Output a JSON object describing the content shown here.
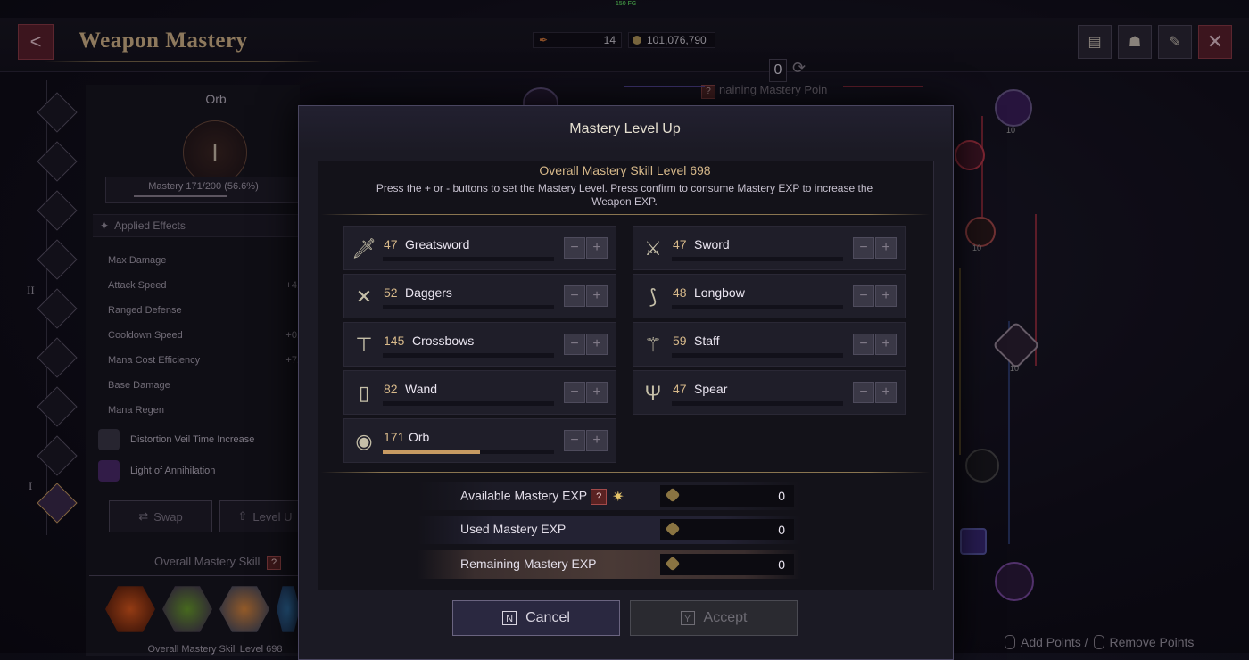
{
  "fps": "150 FG",
  "header": {
    "back_glyph": "<",
    "title": "Weapon Mastery",
    "points_value": "14",
    "currency_value": "101,076,790"
  },
  "top_right_icons": [
    "chat-icon",
    "character-icon",
    "skill-book-icon",
    "close-icon"
  ],
  "tree": {
    "remaining_points_label": "naining Mastery Poin",
    "remaining_points_value": "0",
    "node_levels": [
      "10",
      "10",
      "10"
    ]
  },
  "left_panel": {
    "weapon_title": "Orb",
    "emblem_numeral": "I",
    "mastery_text": "Mastery 171/200 (56.6%)",
    "mastery_progress": 0.566,
    "applied_effects_label": "Applied Effects",
    "effects": [
      {
        "name": "Max Damage",
        "value": ""
      },
      {
        "name": "Attack Speed",
        "value": "+4."
      },
      {
        "name": "Ranged Defense",
        "value": ""
      },
      {
        "name": "Cooldown Speed",
        "value": "+0."
      },
      {
        "name": "Mana Cost Efficiency",
        "value": "+7."
      },
      {
        "name": "Base Damage",
        "value": ""
      },
      {
        "name": "Mana Regen",
        "value": ""
      }
    ],
    "special_effects": [
      "Distortion Veil Time Increase",
      "Light of Annihilation"
    ],
    "swap_label": "Swap",
    "level_up_label": "Level U",
    "overall_skill_title": "Overall Mastery Skill",
    "overall_skill_level": "Overall Mastery Skill Level 698",
    "roman_marks": [
      "II",
      "I"
    ]
  },
  "footer_hint": {
    "add": "Add Points /",
    "remove": "Remove Points"
  },
  "modal": {
    "title": "Mastery Level Up",
    "overall_level": "Overall Mastery Skill Level 698",
    "description": "Press the + or - buttons to set the Mastery Level. Press confirm to consume Mastery EXP to increase the Weapon EXP.",
    "weapons": [
      {
        "level": "47",
        "name": "Greatsword",
        "icon": "greatsword-icon",
        "glyph": "🗡",
        "progress": 0
      },
      {
        "level": "47",
        "name": "Sword",
        "icon": "sword-icon",
        "glyph": "⚔",
        "progress": 0
      },
      {
        "level": "52",
        "name": "Daggers",
        "icon": "daggers-icon",
        "glyph": "✕",
        "progress": 0
      },
      {
        "level": "48",
        "name": "Longbow",
        "icon": "longbow-icon",
        "glyph": "⟆",
        "progress": 0
      },
      {
        "level": "145",
        "name": "Crossbows",
        "icon": "crossbow-icon",
        "glyph": "⊤",
        "progress": 0
      },
      {
        "level": "59",
        "name": "Staff",
        "icon": "staff-icon",
        "glyph": "⚚",
        "progress": 0
      },
      {
        "level": "82",
        "name": "Wand",
        "icon": "wand-icon",
        "glyph": "▯",
        "progress": 0
      },
      {
        "level": "47",
        "name": "Spear",
        "icon": "spear-icon",
        "glyph": "Ψ",
        "progress": 0
      },
      {
        "level": "171",
        "name": "Orb",
        "icon": "orb-icon",
        "glyph": "◉",
        "progress": 0.566
      }
    ],
    "minus_glyph": "−",
    "plus_glyph": "+",
    "exp": {
      "available_label": "Available Mastery EXP",
      "available_value": "0",
      "used_label": "Used Mastery EXP",
      "used_value": "0",
      "remaining_label": "Remaining Mastery EXP",
      "remaining_value": "0"
    },
    "cancel": {
      "key": "N",
      "label": "Cancel"
    },
    "accept": {
      "key": "Y",
      "label": "Accept"
    }
  }
}
